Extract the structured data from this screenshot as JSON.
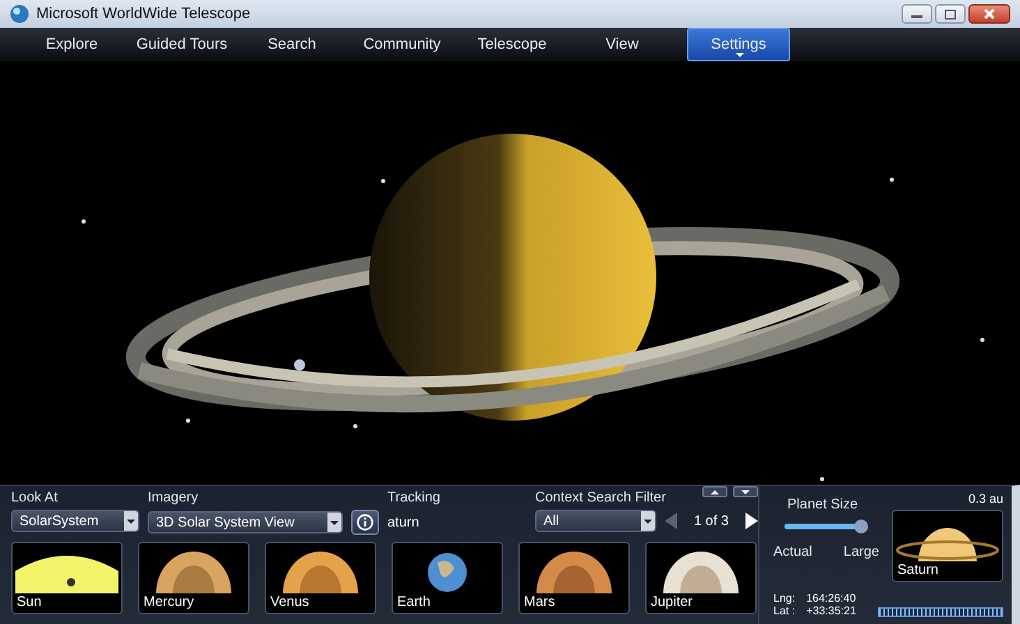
{
  "window": {
    "title": "Microsoft WorldWide Telescope"
  },
  "tabs": [
    {
      "label": "Explore",
      "selected": false
    },
    {
      "label": "Guided Tours",
      "selected": false
    },
    {
      "label": "Search",
      "selected": false
    },
    {
      "label": "Community",
      "selected": false
    },
    {
      "label": "Telescope",
      "selected": false
    },
    {
      "label": "View",
      "selected": false
    },
    {
      "label": "Settings",
      "selected": true
    }
  ],
  "look_at": {
    "label": "Look At",
    "value": "SolarSystem"
  },
  "imagery": {
    "label": "Imagery",
    "value": "3D Solar System View"
  },
  "tracking": {
    "label": "Tracking",
    "value": "aturn"
  },
  "context_search_filter": {
    "label": "Context Search Filter",
    "value": "All"
  },
  "pager": {
    "text": "1 of 3",
    "prev_disabled": true,
    "next_disabled": false
  },
  "thumbnails": [
    {
      "name": "Sun",
      "kind": "sun"
    },
    {
      "name": "Mercury",
      "kind": "mercury"
    },
    {
      "name": "Venus",
      "kind": "venus"
    },
    {
      "name": "Earth",
      "kind": "earth"
    },
    {
      "name": "Mars",
      "kind": "mars"
    },
    {
      "name": "Jupiter",
      "kind": "jupiter"
    }
  ],
  "planet_size": {
    "label": "Planet Size",
    "level": 1.0,
    "min_label": "Actual",
    "max_label": "Large"
  },
  "distance": "0.3 au",
  "selected_object": {
    "name": "Saturn",
    "kind": "saturn"
  },
  "coordinates": {
    "lng_label": "Lng:",
    "lng": "164:26:40",
    "lat_label": "Lat :",
    "lat": "+33:35:21"
  }
}
